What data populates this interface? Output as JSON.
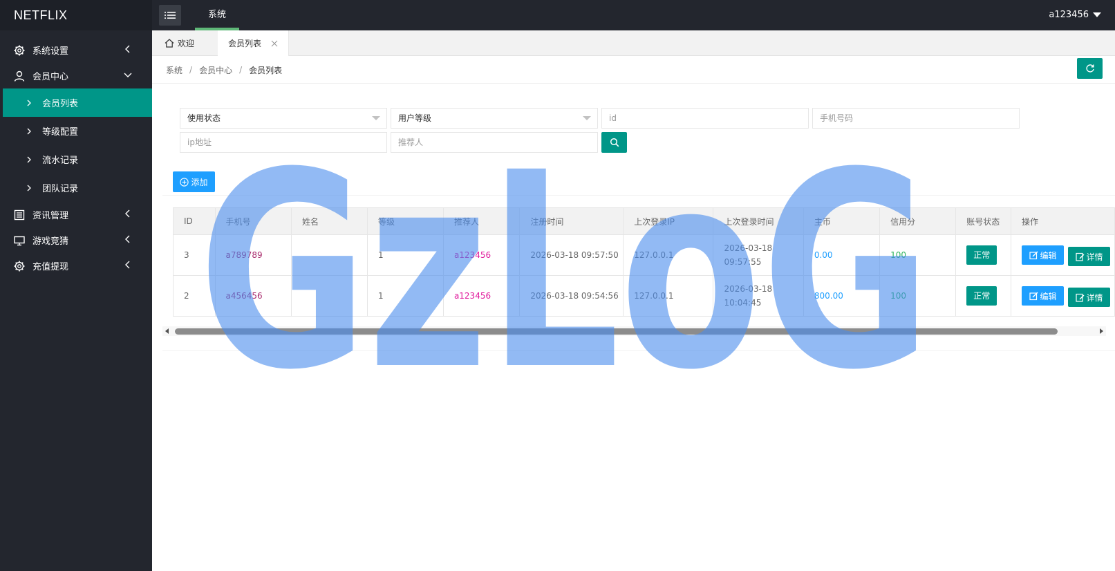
{
  "app": {
    "logo": "NETFLIX",
    "top_tab": "系统",
    "user": "a123456"
  },
  "sidebar": {
    "groups": [
      {
        "label": "系统设置",
        "icon": "gear-icon",
        "expanded": false
      },
      {
        "label": "会员中心",
        "icon": "user-icon",
        "expanded": true,
        "items": [
          "会员列表",
          "等级配置",
          "流水记录",
          "团队记录"
        ],
        "active": "会员列表"
      },
      {
        "label": "资讯管理",
        "icon": "news-icon",
        "expanded": false
      },
      {
        "label": "游戏竞猜",
        "icon": "monitor-icon",
        "expanded": false
      },
      {
        "label": "充值提现",
        "icon": "gear-icon",
        "expanded": false
      }
    ]
  },
  "tabs": {
    "home": "欢迎",
    "active": "会员列表"
  },
  "breadcrumb": [
    "系统",
    "会员中心",
    "会员列表"
  ],
  "filters": {
    "status_select": "使用状态",
    "level_select": "用户等级",
    "id_placeholder": "id",
    "phone_placeholder": "手机号码",
    "ip_placeholder": "ip地址",
    "referrer_placeholder": "推荐人"
  },
  "add_button": "添加",
  "table": {
    "headers": [
      "ID",
      "手机号",
      "姓名",
      "等级",
      "推荐人",
      "注册时间",
      "上次登录IP",
      "上次登录时间",
      "主币",
      "信用分",
      "账号状态",
      "操作"
    ],
    "rows": [
      {
        "id": "3",
        "phone": "a789789",
        "name": "",
        "level": "1",
        "referrer": "a123456",
        "reg_time": "2026-03-18 09:57:50",
        "last_ip": "127.0.0.1",
        "last_login": "2026-03-18 09:57:55",
        "coin": "0.00",
        "credit": "100",
        "status": "正常"
      },
      {
        "id": "2",
        "phone": "a456456",
        "name": "",
        "level": "1",
        "referrer": "a123456",
        "reg_time": "2026-03-18 09:54:56",
        "last_ip": "127.0.0.1",
        "last_login": "2026-03-18 10:04:45",
        "coin": "800.00",
        "credit": "100",
        "status": "正常"
      }
    ],
    "edit_label": "编辑",
    "detail_label": "详情"
  },
  "watermark": "GzLoG",
  "colors": {
    "primary": "#009688",
    "blue": "#1e9fff",
    "dark": "#23262e",
    "watermark": "#4a8cec"
  }
}
